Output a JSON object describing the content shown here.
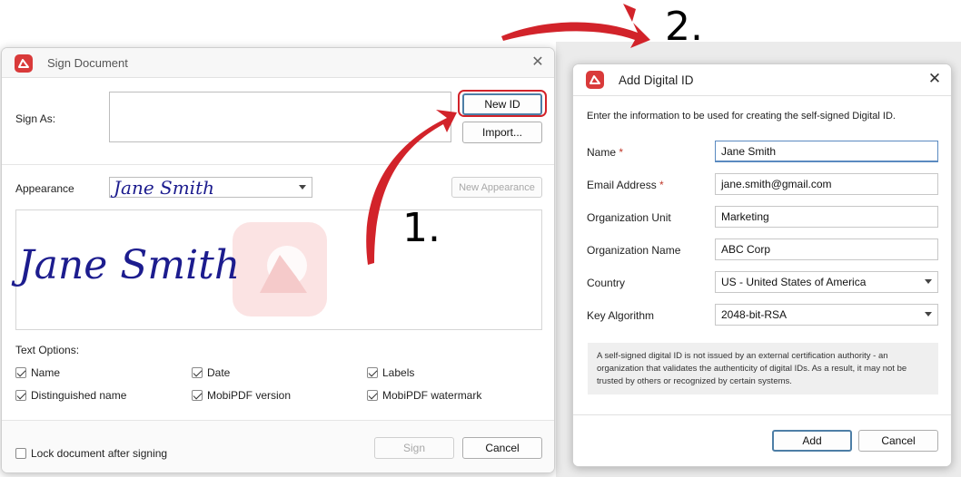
{
  "sign_window": {
    "title": "Sign Document",
    "sign_as_label": "Sign As:",
    "new_id_label": "New ID",
    "import_label": "Import...",
    "appearance_label": "Appearance",
    "appearance_value": "Jane Smith",
    "new_appearance_label": "New Appearance",
    "preview_signature": "Jane Smith",
    "text_options_label": "Text Options:",
    "options": [
      {
        "label": "Name",
        "checked": true
      },
      {
        "label": "Date",
        "checked": true
      },
      {
        "label": "Labels",
        "checked": true
      },
      {
        "label": "Distinguished name",
        "checked": true
      },
      {
        "label": "MobiPDF version",
        "checked": true
      },
      {
        "label": "MobiPDF watermark",
        "checked": true
      }
    ],
    "lock_label": "Lock document after signing",
    "sign_label": "Sign",
    "cancel_label": "Cancel"
  },
  "add_window": {
    "title": "Add Digital ID",
    "intro": "Enter the information to be used for creating the self-signed Digital ID.",
    "fields": {
      "name": {
        "label": "Name",
        "value": "Jane Smith"
      },
      "email": {
        "label": "Email Address",
        "value": "jane.smith@gmail.com"
      },
      "org_unit": {
        "label": "Organization Unit",
        "value": "Marketing"
      },
      "org_name": {
        "label": "Organization Name",
        "value": "ABC Corp"
      },
      "country": {
        "label": "Country",
        "value": "US - United States of America"
      },
      "key_algorithm": {
        "label": "Key Algorithm",
        "value": "2048-bit-RSA"
      }
    },
    "required_mark": "*",
    "info": "A self-signed digital ID is not issued by an external certification authority - an organization that validates the authenticity of digital IDs. As a result, it may not be trusted by others or recognized by certain systems.",
    "add_label": "Add",
    "cancel_label": "Cancel"
  },
  "annotations": {
    "step1": "1.",
    "step2": "2."
  },
  "colors": {
    "arrow": "#d2232a",
    "brand": "#d93a3a",
    "signature_ink": "#1c1c8e"
  }
}
